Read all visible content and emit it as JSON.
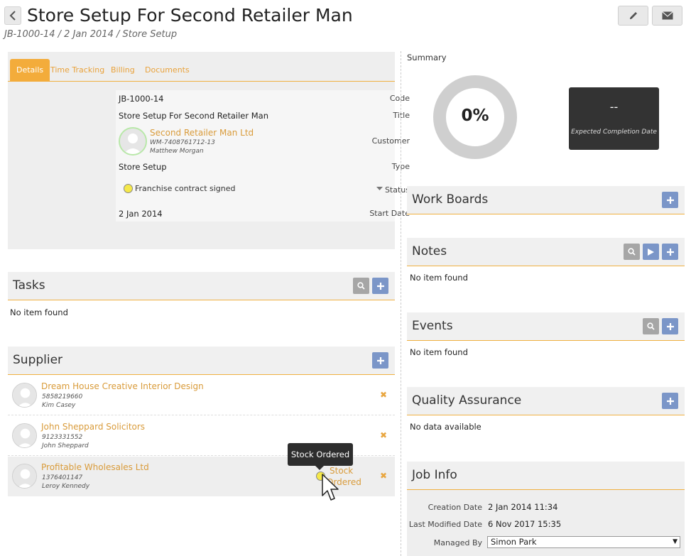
{
  "header": {
    "title": "Store Setup For Second Retailer Man",
    "breadcrumb": "JB-1000-14 / 2 Jan 2014 / Store Setup",
    "edit_icon": "pencil-icon",
    "email_icon": "envelope-icon"
  },
  "tabs": [
    {
      "label": "Details",
      "active": true
    },
    {
      "label": "Time Tracking",
      "active": false
    },
    {
      "label": "Billing",
      "active": false
    },
    {
      "label": "Documents",
      "active": false
    }
  ],
  "details": {
    "code_label": "Code",
    "code_value": "JB-1000-14",
    "title_label": "Title",
    "title_value": "Store Setup For Second Retailer Man",
    "customer_label": "Customer",
    "customer_name": "Second Retailer Man Ltd",
    "customer_id": "WM-7408761712-13",
    "customer_contact": "Matthew Morgan",
    "type_label": "Type",
    "type_value": "Store Setup",
    "status_label": "Status",
    "status_value": "Franchise contract signed",
    "start_date_label": "Start Date",
    "start_date_value": "2 Jan 2014"
  },
  "tasks": {
    "title": "Tasks",
    "empty": "No item found"
  },
  "supplier": {
    "title": "Supplier",
    "items": [
      {
        "name": "Dream House Creative Interior Design",
        "phone": "5858219660",
        "contact": "Kim Casey"
      },
      {
        "name": "John Sheppard Solicitors",
        "phone": "9123331552",
        "contact": "John Sheppard"
      },
      {
        "name": "Profitable Wholesales Ltd",
        "phone": "1376401147",
        "contact": "Leroy Kennedy",
        "status_line1": "Stock",
        "status_line2": "Ordered"
      }
    ],
    "tooltip": "Stock Ordered"
  },
  "summary": {
    "label": "Summary",
    "percent": "0%",
    "progress_fraction": 0,
    "ecd_value": "--",
    "ecd_label": "Expected Completion Date"
  },
  "work_boards": {
    "title": "Work Boards"
  },
  "notes": {
    "title": "Notes",
    "empty": "No item found"
  },
  "events": {
    "title": "Events",
    "empty": "No item found"
  },
  "quality": {
    "title": "Quality Assurance",
    "empty": "No data available"
  },
  "job_info": {
    "title": "Job Info",
    "creation_label": "Creation Date",
    "creation_value": "2 Jan 2014 11:34",
    "modified_label": "Last Modified Date",
    "modified_value": "6 Nov 2017 15:35",
    "managed_label": "Managed By",
    "managed_value": "Simon Park"
  },
  "colors": {
    "accent": "#f3ac3b",
    "link": "#d99b3a",
    "button_blue": "#7b96c8",
    "button_grey": "#a6a6a6",
    "status_yellow": "#f5e84a"
  }
}
